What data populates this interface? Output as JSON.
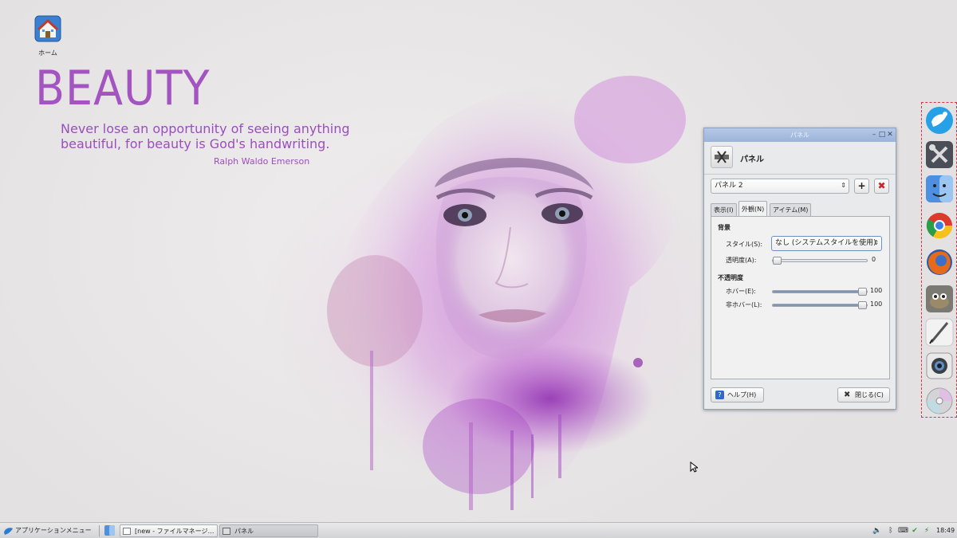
{
  "desktop": {
    "home_icon_label": "ホーム",
    "wallpaper": {
      "title": "BEAUTY",
      "quote_line1": "Never lose an opportunity of seeing anything",
      "quote_line2": "beautiful, for beauty is God's handwriting.",
      "author": "Ralph Waldo Emerson"
    }
  },
  "dialog": {
    "window_title": "パネル",
    "header_title": "パネル",
    "panel_selector_value": "パネル 2",
    "tabs": [
      {
        "label": "表示(I)"
      },
      {
        "label": "外観(N)"
      },
      {
        "label": "アイテム(M)"
      }
    ],
    "background_section": "背景",
    "style_label": "スタイル(S):",
    "style_value": "なし (システムスタイルを使用)",
    "transparency_label": "透明度(A):",
    "transparency_value": "0",
    "transparency": 0,
    "opacity_section": "不透明度",
    "hover_label": "ホバー(E):",
    "hover_value": "100",
    "hover": 100,
    "nonhover_label": "非ホバー(L):",
    "nonhover_value": "100",
    "nonhover": 100,
    "help_label": "ヘルプ(H)",
    "close_label": "閉じる(C)"
  },
  "dock": {
    "items": [
      "xfce-mouse-icon",
      "settings-tools-icon",
      "finder-icon",
      "chrome-icon",
      "firefox-icon",
      "gimp-icon",
      "pen-icon",
      "camera-icon",
      "disc-icon"
    ]
  },
  "taskbar": {
    "app_menu_label": "アプリケーションメニュー",
    "tasks": [
      {
        "label": "[new - ファイルマネージ…"
      },
      {
        "label": "パネル"
      }
    ],
    "clock": "18:49"
  },
  "colors": {
    "accent_purple": "#a354c0",
    "titlebar_blue": "#9cb4da",
    "dock_border": "#e0303a"
  }
}
